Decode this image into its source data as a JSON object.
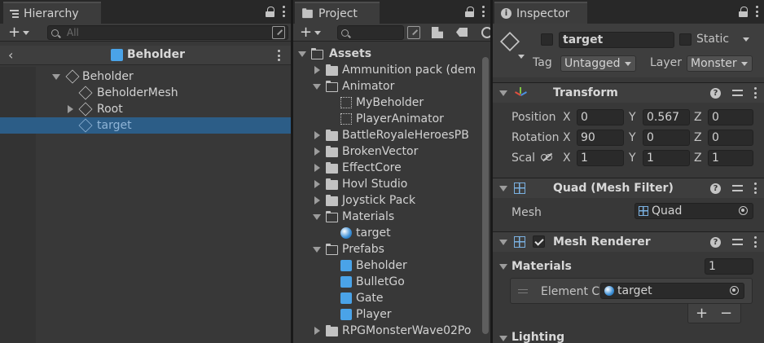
{
  "hierarchy": {
    "tab_label": "Hierarchy",
    "search_placeholder": "All",
    "scene_header": "Beholder",
    "items": [
      {
        "label": "Beholder"
      },
      {
        "label": "BeholderMesh"
      },
      {
        "label": "Root"
      },
      {
        "label": "target"
      }
    ]
  },
  "project": {
    "tab_label": "Project",
    "items": [
      {
        "label": "Assets"
      },
      {
        "label": "Ammunition pack (dem"
      },
      {
        "label": "Animator"
      },
      {
        "label": "MyBeholder"
      },
      {
        "label": "PlayerAnimator"
      },
      {
        "label": "BattleRoyaleHeroesPB"
      },
      {
        "label": "BrokenVector"
      },
      {
        "label": "EffectCore"
      },
      {
        "label": "Hovl Studio"
      },
      {
        "label": "Joystick Pack"
      },
      {
        "label": "Materials"
      },
      {
        "label": "target"
      },
      {
        "label": "Prefabs"
      },
      {
        "label": "Beholder"
      },
      {
        "label": "BulletGo"
      },
      {
        "label": "Gate"
      },
      {
        "label": "Player"
      },
      {
        "label": "RPGMonsterWave02Po"
      }
    ]
  },
  "inspector": {
    "tab_label": "Inspector",
    "object_name": "target",
    "static_label": "Static",
    "tag_label": "Tag",
    "tag_value": "Untagged",
    "layer_label": "Layer",
    "layer_value": "Monster",
    "transform": {
      "title": "Transform",
      "position_label": "Position",
      "rotation_label": "Rotation",
      "scale_label": "Scal",
      "x": "X",
      "y": "Y",
      "z": "Z",
      "position": [
        "0",
        "0.567",
        "0"
      ],
      "rotation": [
        "90",
        "0",
        "0"
      ],
      "scale": [
        "1",
        "1",
        "1"
      ]
    },
    "mesh_filter": {
      "title": "Quad (Mesh Filter)",
      "mesh_label": "Mesh",
      "mesh_value": "Quad"
    },
    "mesh_renderer": {
      "title": "Mesh Renderer",
      "materials_label": "Materials",
      "materials_count": "1",
      "element_label": "Element C",
      "element_value": "target",
      "plus": "+",
      "minus": "−",
      "lighting_label": "Lighting"
    }
  }
}
